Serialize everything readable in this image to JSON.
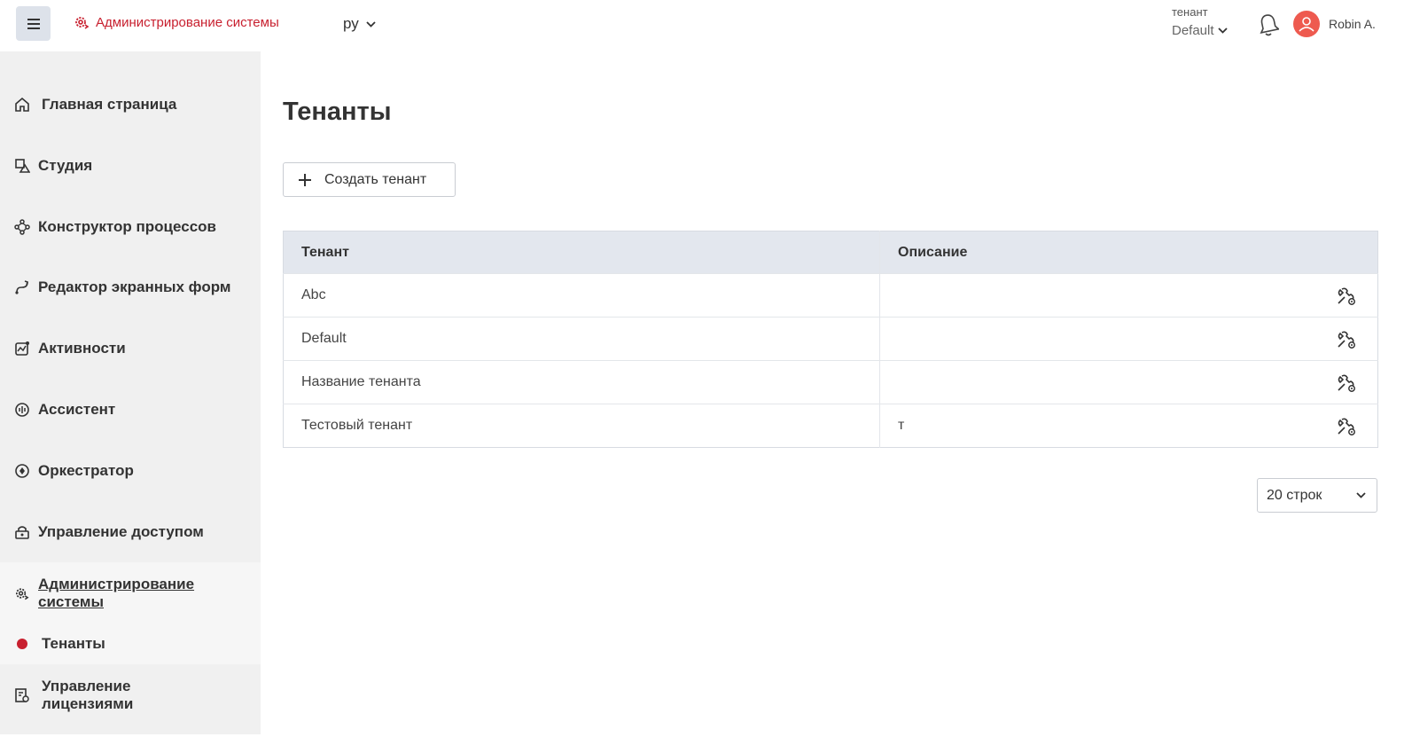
{
  "header": {
    "brand_label": "Администрирование системы",
    "language": "ру",
    "tenant_label": "тенант",
    "tenant_value": "Default",
    "user_name": "Robin A."
  },
  "sidebar": {
    "items": [
      {
        "label": "Главная страница",
        "icon": "home-icon"
      },
      {
        "label": "Студия",
        "icon": "studio-icon"
      },
      {
        "label": "Конструктор процессов",
        "icon": "process-icon"
      },
      {
        "label": "Редактор экранных форм",
        "icon": "form-editor-icon"
      },
      {
        "label": "Активности",
        "icon": "activity-icon"
      },
      {
        "label": "Ассистент",
        "icon": "assistant-icon"
      },
      {
        "label": "Оркестратор",
        "icon": "orchestrator-icon"
      },
      {
        "label": "Управление доступом",
        "icon": "access-icon"
      },
      {
        "label": "Администрирование системы",
        "icon": "admin-icon"
      },
      {
        "label": "Тенанты",
        "icon": "dot-icon"
      },
      {
        "label": "Управление лицензиями",
        "icon": "license-icon"
      }
    ]
  },
  "main": {
    "title": "Тенанты",
    "create_button": "Создать тенант",
    "table": {
      "columns": [
        "Тенант",
        "Описание"
      ],
      "rows": [
        {
          "tenant": "Abc",
          "description": ""
        },
        {
          "tenant": "Default",
          "description": ""
        },
        {
          "tenant": "Название тенанта",
          "description": ""
        },
        {
          "tenant": "Тестовый тенант",
          "description": "т"
        }
      ]
    },
    "rows_per_page": "20 строк"
  },
  "colors": {
    "accent": "#c8202f",
    "sidebar_bg": "#f0f0f0",
    "table_header_bg": "#e3e7ee",
    "menu_button_bg": "#dde2ea",
    "avatar": "#ee5a4f"
  }
}
